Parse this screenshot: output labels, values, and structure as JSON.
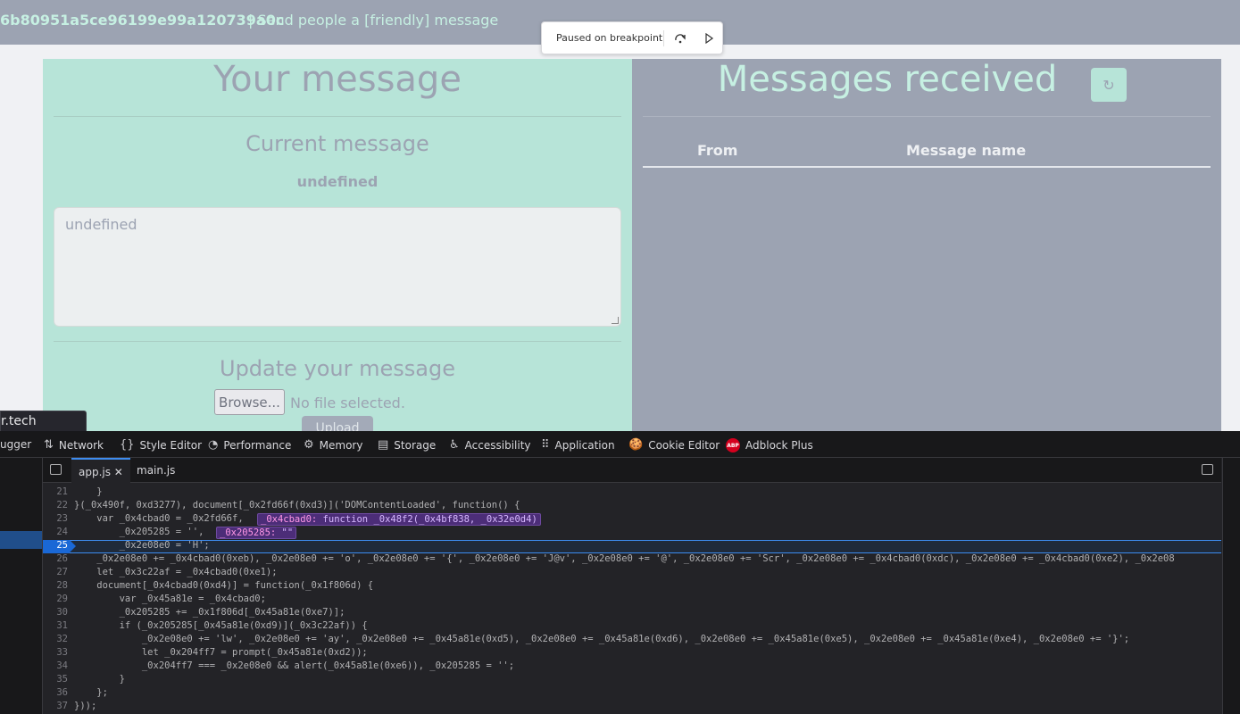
{
  "page": {
    "hash_text": "6b80951a5ce96199e99a120739a0c",
    "tagline": "| Send people a [friendly] message"
  },
  "debugger_overlay": {
    "label": "Paused on breakpoint",
    "step_over_icon": "step-over-icon",
    "resume_icon": "resume-icon"
  },
  "left_panel": {
    "title": "Your message",
    "current_heading": "Current message",
    "current_name": "undefined",
    "textarea_value": "undefined",
    "update_heading": "Update your message",
    "browse_label": "Browse...",
    "no_file_label": "No file selected.",
    "upload_label": "Upload"
  },
  "right_panel": {
    "title": "Messages received",
    "refresh_icon": "↻",
    "columns": [
      "From",
      "Message name"
    ]
  },
  "tooltip": {
    "text": "r.tech"
  },
  "devtools": {
    "tabs": [
      {
        "label": "ugger",
        "icon": ""
      },
      {
        "label": "Network",
        "icon": "⇅"
      },
      {
        "label": "Style Editor",
        "icon": "{}"
      },
      {
        "label": "Performance",
        "icon": "◔"
      },
      {
        "label": "Memory",
        "icon": "⚙"
      },
      {
        "label": "Storage",
        "icon": "▤"
      },
      {
        "label": "Accessibility",
        "icon": "♿"
      },
      {
        "label": "Application",
        "icon": "⠿"
      },
      {
        "label": "Cookie Editor",
        "icon": "🍪"
      },
      {
        "label": "Adblock Plus",
        "icon": "ABP"
      }
    ],
    "source_tabs": [
      {
        "label": "app.js ✕",
        "active": true
      },
      {
        "label": "main.js",
        "active": false
      }
    ],
    "line_numbers": [
      "21",
      "22",
      "23",
      "24",
      "25",
      "26",
      "27",
      "28",
      "29",
      "30",
      "31",
      "32",
      "33",
      "34",
      "35",
      "36",
      "37"
    ],
    "breakpoint_line": "25",
    "code_lines": [
      "    }",
      "}(_0x490f, 0xd3277), document[_0x2fd66f(0xd3)]('DOMContentLoaded', function() {",
      "    var _0x4cbad0 = _0x2fd66f,",
      "        _0x205285 = '',",
      "        _0x2e08e0 = 'H';",
      "    _0x2e08e0 += _0x4cbad0(0xeb), _0x2e08e0 += 'o', _0x2e08e0 += '{', _0x2e08e0 += 'J@v', _0x2e08e0 += '@', _0x2e08e0 += 'Scr', _0x2e08e0 += _0x4cbad0(0xdc), _0x2e08e0 += _0x4cbad0(0xe2), _0x2e08",
      "    let _0x3c22af = _0x4cbad0(0xe1);",
      "    document[_0x4cbad0(0xd4)] = function(_0x1f806d) {",
      "        var _0x45a81e = _0x4cbad0;",
      "        _0x205285 += _0x1f806d[_0x45a81e(0xe7)];",
      "        if (_0x205285[_0x45a81e(0xd9)](_0x3c22af)) {",
      "            _0x2e08e0 += 'lw', _0x2e08e0 += 'ay', _0x2e08e0 += _0x45a81e(0xd5), _0x2e08e0 += _0x45a81e(0xd6), _0x2e08e0 += _0x45a81e(0xe5), _0x2e08e0 += _0x45a81e(0xe4), _0x2e08e0 += '}';",
      "            let _0x204ff7 = prompt(_0x45a81e(0xd2));",
      "            _0x204ff7 === _0x2e08e0 && alert(_0x45a81e(0xe6)), _0x205285 = '';",
      "        }",
      "    };",
      "}));"
    ],
    "preview_1_key": "_0x4cbad0:",
    "preview_1_val": "function _0x48f2(_0x4bf838, _0x32e0d4)",
    "preview_2_key": "_0x205285:",
    "preview_2_val": "\"\""
  }
}
